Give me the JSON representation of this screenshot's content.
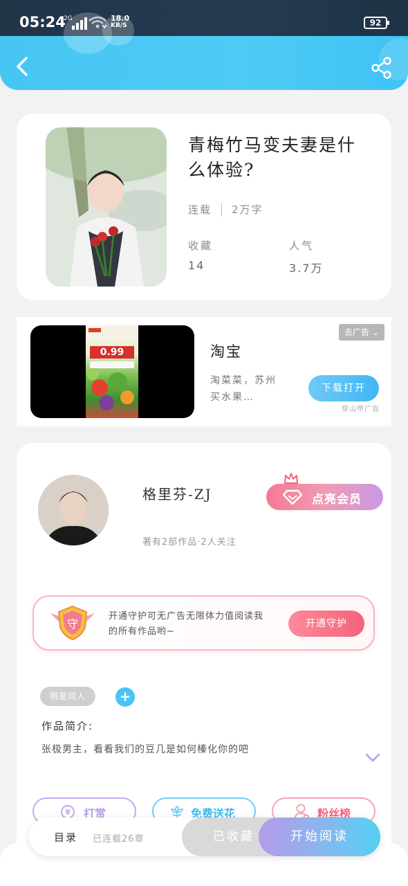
{
  "status_bar": {
    "time": "05:24",
    "network": "2G",
    "speed_value": "18.0",
    "speed_unit": "KB/S",
    "battery": "92"
  },
  "nav": {
    "back_icon": "chevron-left-icon",
    "share_icon": "share-icon"
  },
  "book": {
    "title": "青梅竹马变夫妻是什么体验?",
    "status": "连载",
    "word_count": "2万字",
    "favorites_label": "收藏",
    "favorites_value": "14",
    "popularity_label": "人气",
    "popularity_value": "3.7万"
  },
  "ad": {
    "tag": "去广告",
    "name": "淘宝",
    "description": "淘菜菜，苏州买水果…",
    "button": "下载打开",
    "source": "穿山甲广告",
    "poster_price": "0.99"
  },
  "author": {
    "name": "格里芬-ZJ",
    "info": "著有2部作品·2人关注",
    "vip_button": "点亮会员",
    "guard_text": "开通守护可无广告无限体力值阅读我的所有作品哟~",
    "guard_button": "开通守护",
    "guard_badge": "守"
  },
  "tags": {
    "items": [
      "明星同人"
    ],
    "add_label": "+"
  },
  "intro": {
    "label": "作品简介:",
    "text": "张极男主，看看我们的豆几是如何榛化你的吧"
  },
  "actions": {
    "tip": "打赏",
    "flower": "免费送花",
    "fans": "粉丝榜"
  },
  "bottom": {
    "toc": "目录",
    "serial": "已连载26章",
    "collected": "已收藏",
    "read": "开始阅读"
  },
  "colors": {
    "header": "#47c6f3",
    "accent_blue": "#4bc3f4",
    "pink": "#f4637a",
    "purple": "#b69be8"
  }
}
